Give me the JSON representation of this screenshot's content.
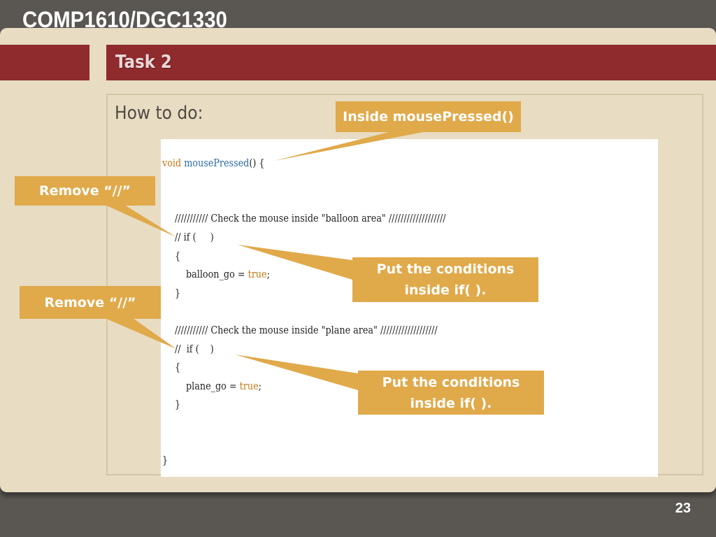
{
  "header": {
    "course_title": "COMP1610/DGC1330"
  },
  "slide": {
    "title": "Task 2",
    "subtitle": "How to do:",
    "page_number": "23"
  },
  "code": {
    "line1_kw": "void",
    "line1_fn": "mousePressed",
    "line1_rest": "() {",
    "line2": "/////////// Check the mouse inside \"balloon area\" ///////////////////",
    "line3": "// if (     )",
    "line4": "{",
    "line5_pre": "balloon_go = ",
    "line5_kw": "true",
    "line5_post": ";",
    "line6": "}",
    "line7": "/////////// Check the mouse inside \"plane area\" ///////////////////",
    "line8": "//  if (    )",
    "line9": "{",
    "line10_pre": "plane_go = ",
    "line10_kw": "true",
    "line10_post": ";",
    "line11": "}",
    "line12": "}"
  },
  "callouts": {
    "inside_mousepressed": "Inside mousePressed()",
    "remove1": "Remove “//”",
    "remove2": "Remove “//”",
    "conditions1_l1": "Put the conditions",
    "conditions1_l2": "inside if(   ).",
    "conditions2_l1": "Put the conditions",
    "conditions2_l2": "inside if(   )."
  },
  "colors": {
    "accent_red": "#8f2a2d",
    "callout_orange": "#e0a94a",
    "slide_bg": "#e8dcc2",
    "keyword": "#c77712",
    "function": "#2a6aa8"
  }
}
